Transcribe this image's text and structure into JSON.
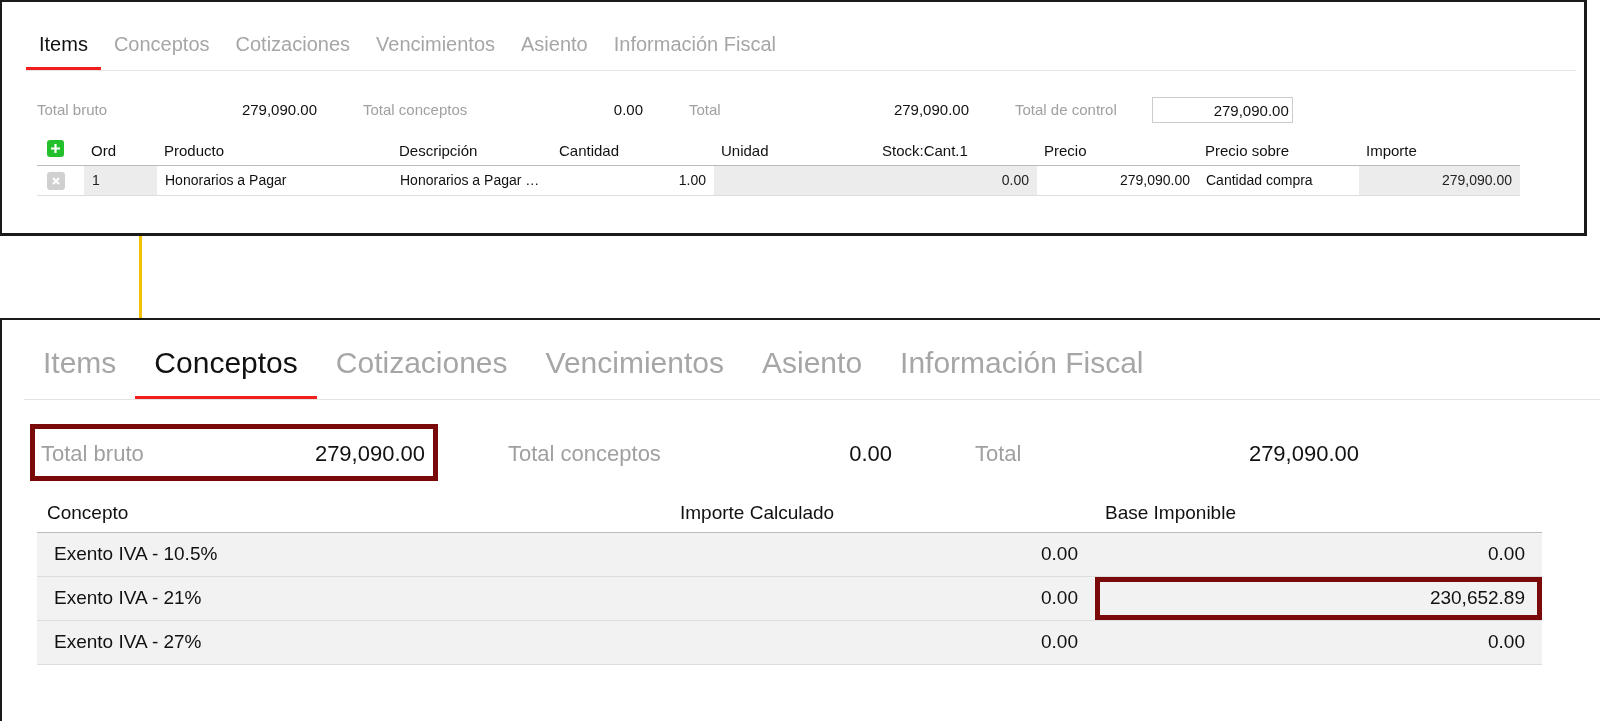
{
  "items_view": {
    "tabs": [
      {
        "label": "Items",
        "selected": true
      },
      {
        "label": "Conceptos",
        "selected": false
      },
      {
        "label": "Cotizaciones",
        "selected": false
      },
      {
        "label": "Vencimientos",
        "selected": false
      },
      {
        "label": "Asiento",
        "selected": false
      },
      {
        "label": "Información Fiscal",
        "selected": false
      }
    ],
    "totals": [
      {
        "label": "Total bruto",
        "value": "279,090.00"
      },
      {
        "label": "Total conceptos",
        "value": "0.00"
      },
      {
        "label": "Total",
        "value": "279,090.00"
      }
    ],
    "control_total": {
      "label": "Total de control",
      "value": "279,090.00"
    },
    "table": {
      "columns": [
        "Ord",
        "Producto",
        "Descripción",
        "Cantidad",
        "Unidad",
        "Stock:Cant.1",
        "Precio",
        "Precio sobre",
        "Importe"
      ],
      "rows": [
        {
          "cells": [
            {
              "text": "1",
              "readonly": true
            },
            {
              "text": "Honorarios a Pagar",
              "readonly": false
            },
            {
              "text": "Honorarios a Pagar …",
              "readonly": false
            },
            {
              "text": "1.00",
              "readonly": false
            },
            {
              "text": "",
              "readonly": true
            },
            {
              "text": "0.00",
              "readonly": true
            },
            {
              "text": "279,090.00",
              "readonly": false
            },
            {
              "text": "Cantidad compra",
              "readonly": false
            },
            {
              "text": "279,090.00",
              "readonly": true
            }
          ]
        }
      ]
    }
  },
  "conceptos_view": {
    "tabs": [
      {
        "label": "Items",
        "selected": false
      },
      {
        "label": "Conceptos",
        "selected": true
      },
      {
        "label": "Cotizaciones",
        "selected": false
      },
      {
        "label": "Vencimientos",
        "selected": false
      },
      {
        "label": "Asiento",
        "selected": false
      },
      {
        "label": "Información Fiscal",
        "selected": false
      }
    ],
    "totals": [
      {
        "label": "Total bruto",
        "value": "279,090.00",
        "highlighted": true
      },
      {
        "label": "Total conceptos",
        "value": "0.00",
        "highlighted": false
      },
      {
        "label": "Total",
        "value": "279,090.00",
        "highlighted": false
      }
    ],
    "table": {
      "columns": [
        "Concepto",
        "Importe Calculado",
        "Base Imponible"
      ],
      "rows": [
        {
          "cells": [
            {
              "text": "Exento IVA - 10.5%",
              "highlighted": false
            },
            {
              "text": "0.00",
              "highlighted": false
            },
            {
              "text": "0.00",
              "highlighted": false
            }
          ]
        },
        {
          "cells": [
            {
              "text": "Exento IVA - 21%",
              "highlighted": false
            },
            {
              "text": "0.00",
              "highlighted": false
            },
            {
              "text": "230,652.89",
              "highlighted": true
            }
          ]
        },
        {
          "cells": [
            {
              "text": "Exento IVA - 27%",
              "highlighted": false
            },
            {
              "text": "0.00",
              "highlighted": false
            },
            {
              "text": "0.00",
              "highlighted": false
            }
          ]
        }
      ]
    }
  }
}
